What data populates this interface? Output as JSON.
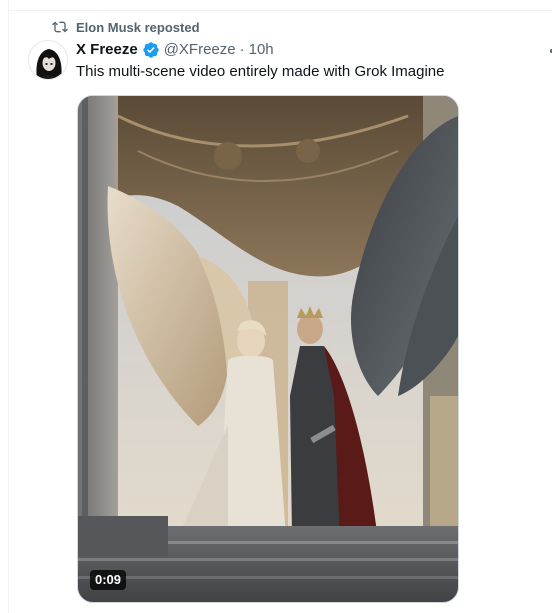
{
  "repost": {
    "icon": "repost-icon",
    "label": "Elon Musk reposted"
  },
  "tweet": {
    "author": {
      "display_name": "X Freeze",
      "handle": "@XFreeze",
      "verified": true,
      "avatar_icon": "avatar-dark-hair-portrait"
    },
    "separator": "·",
    "time": "10h",
    "text": "This multi-scene video entirely made with Grok Imagine",
    "media": {
      "type": "video",
      "description_icon": "video-thumbnail-angels",
      "duration": "0:09"
    }
  },
  "colors": {
    "text_primary": "#0f1419",
    "text_secondary": "#536471",
    "verified_blue": "#1d9bf0",
    "border": "#cfd9de"
  }
}
